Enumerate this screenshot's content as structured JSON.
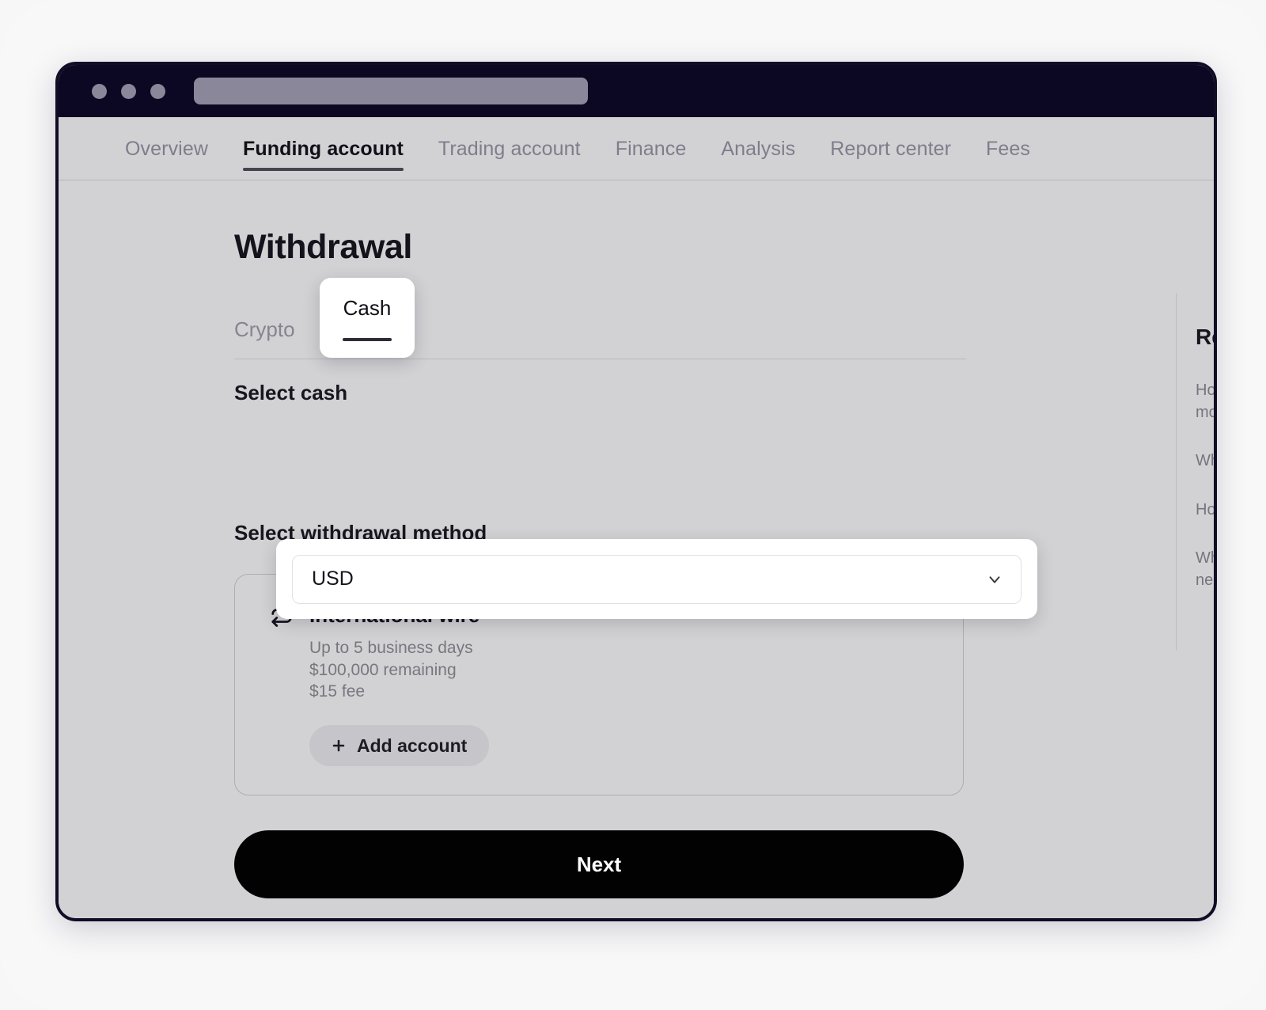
{
  "browser": {
    "dots": [
      "close-dot",
      "minimize-dot",
      "maximize-dot"
    ],
    "url_placeholder": ""
  },
  "nav": {
    "items": [
      {
        "label": "Overview",
        "active": false
      },
      {
        "label": "Funding account",
        "active": true
      },
      {
        "label": "Trading account",
        "active": false
      },
      {
        "label": "Finance",
        "active": false
      },
      {
        "label": "Analysis",
        "active": false
      },
      {
        "label": "Report center",
        "active": false
      },
      {
        "label": "Fees",
        "active": false
      }
    ]
  },
  "main": {
    "title": "Withdrawal",
    "subtabs": {
      "crypto": "Crypto",
      "cash": "Cash",
      "selected": "Cash"
    },
    "select_cash": {
      "label": "Select cash",
      "value": "USD",
      "chevron": "chevron-down-icon"
    },
    "method": {
      "label": "Select withdrawal method",
      "icon": "transfer-arrows-icon",
      "title": "International wire",
      "details": [
        "Up to 5 business days",
        "$100,000 remaining",
        "$15 fee"
      ],
      "add_account_label": "Add account",
      "add_account_icon": "plus-icon"
    },
    "next_label": "Next"
  },
  "related": {
    "title": "Related",
    "questions": [
      "How do\nmobile ",
      "Why ha",
      "How do",
      "When w\nneed to"
    ]
  },
  "colors": {
    "page_background": "#f8f8f9",
    "window_border": "#120d26",
    "titlebar": "#0c0722",
    "viewport": "#d2d2d4",
    "accent_dark": "#020203",
    "muted_text": "#78767f",
    "spotlight": "#ffffff"
  }
}
